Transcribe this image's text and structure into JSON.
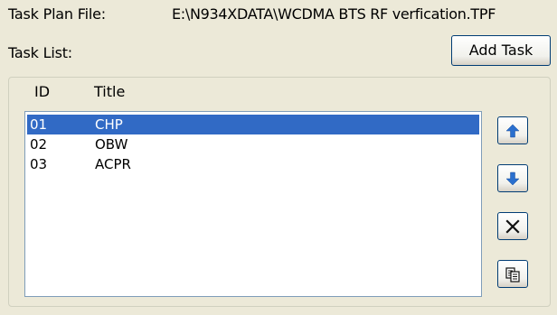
{
  "header": {
    "plan_label": "Task Plan File:",
    "plan_path": "E:\\N934XDATA\\WCDMA BTS RF verfication.TPF",
    "tasklist_label": "Task List:",
    "add_task_label": "Add Task"
  },
  "list": {
    "columns": {
      "id": "ID",
      "title": "Title"
    },
    "rows": [
      {
        "id": "01",
        "title": "CHP",
        "selected": true
      },
      {
        "id": "02",
        "title": "OBW",
        "selected": false
      },
      {
        "id": "03",
        "title": "ACPR",
        "selected": false
      }
    ]
  },
  "buttons": {
    "move_up": "arrow-up-icon",
    "move_down": "arrow-down-icon",
    "delete": "close-icon",
    "copy": "copy-icon"
  },
  "colors": {
    "background": "#ece9d8",
    "selection": "#316ac5",
    "arrow": "#2a6fce",
    "button_border": "#003c74"
  }
}
